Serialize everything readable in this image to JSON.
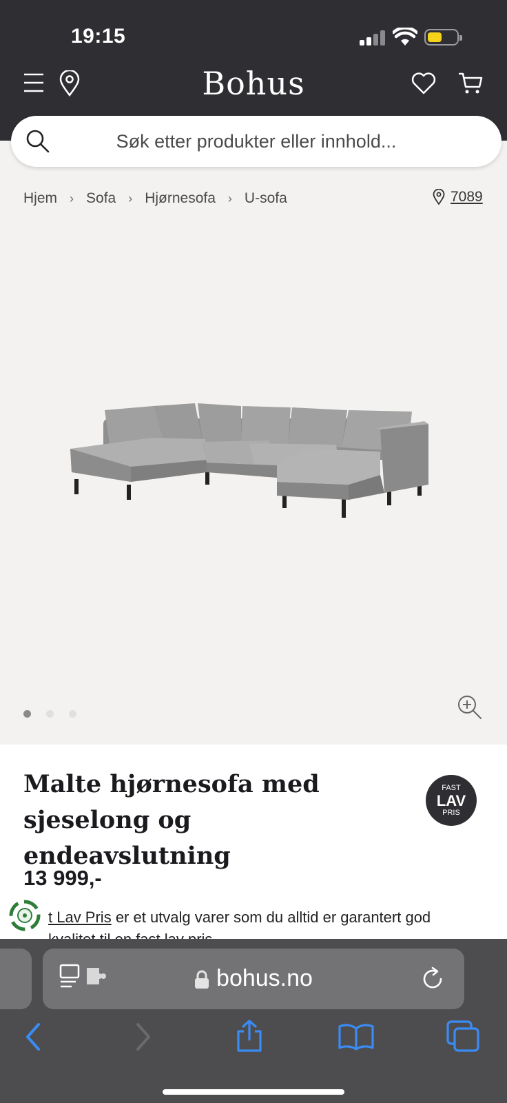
{
  "status": {
    "time": "19:15"
  },
  "header": {
    "logo": "Bohus"
  },
  "search": {
    "placeholder": "Søk etter produkter eller innhold..."
  },
  "breadcrumb": [
    {
      "label": "Hjem"
    },
    {
      "label": "Sofa"
    },
    {
      "label": "Hjørnesofa"
    },
    {
      "label": "U-sofa"
    }
  ],
  "store": {
    "number": "7089"
  },
  "gallery": {
    "image_count": 3,
    "active_index": 0
  },
  "product": {
    "title": "Malte hjørnesofa med sjeselong og endeavslutning",
    "price": "13 999,-",
    "badge": {
      "line1": "FAST",
      "line2": "LAV",
      "line3": "PRIS"
    },
    "desc_link": "t Lav Pris",
    "desc_text": " er et utvalg varer som du alltid er garantert god",
    "desc_line2": "kvalitet til en fast lav pris"
  },
  "browser": {
    "url": "bohus.no"
  },
  "colors": {
    "header_bg": "#2f2f33",
    "page_bg": "#f4f2f0",
    "accent_blue": "#3a8cf5",
    "battery": "#f5d31a"
  }
}
